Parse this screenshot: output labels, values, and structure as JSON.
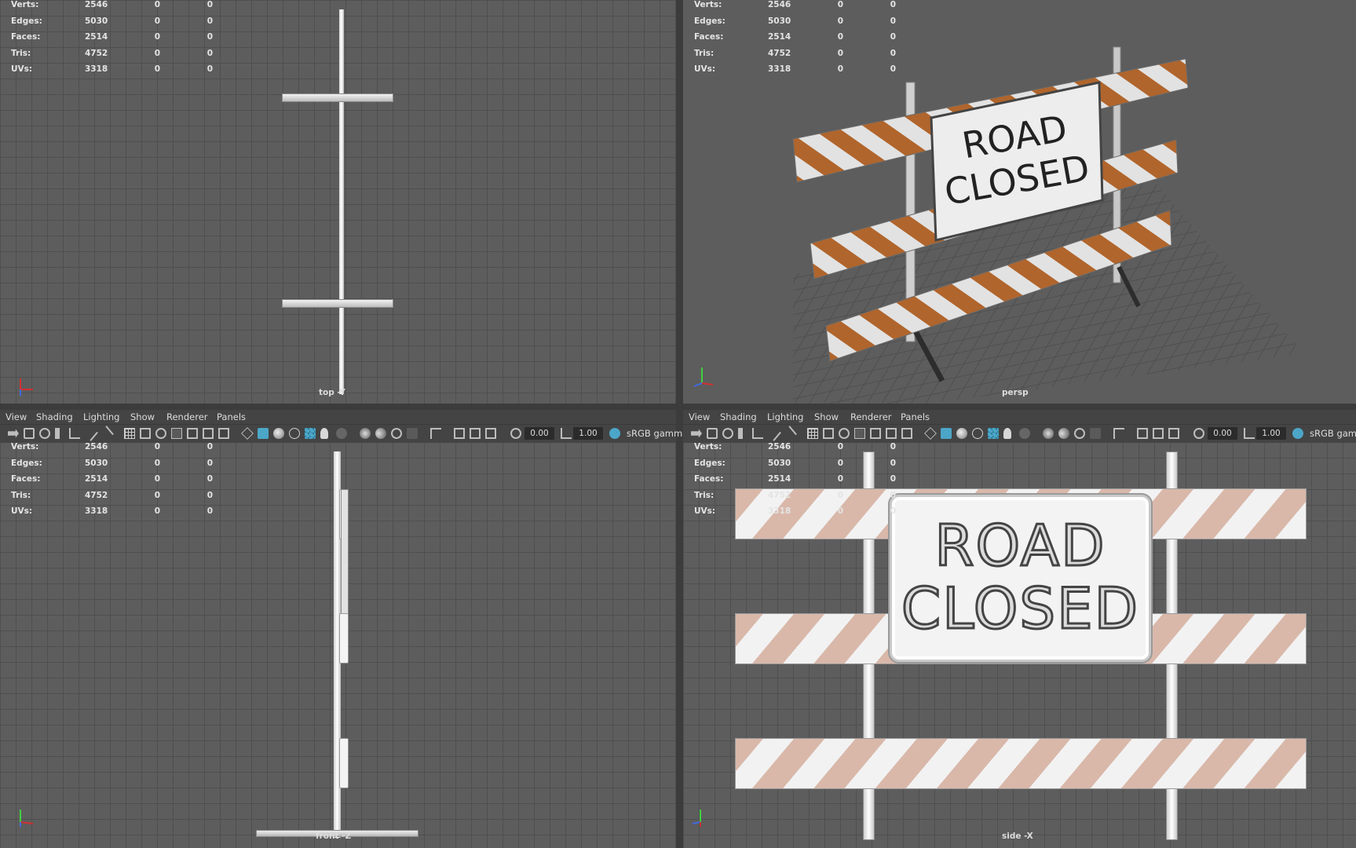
{
  "stats": {
    "rows": [
      {
        "label": "Verts:",
        "v1": "2546",
        "v2": "0",
        "v3": "0"
      },
      {
        "label": "Edges:",
        "v1": "5030",
        "v2": "0",
        "v3": "0"
      },
      {
        "label": "Faces:",
        "v1": "2514",
        "v2": "0",
        "v3": "0"
      },
      {
        "label": "Tris:",
        "v1": "4752",
        "v2": "0",
        "v3": "0"
      },
      {
        "label": "UVs:",
        "v1": "3318",
        "v2": "0",
        "v3": "0"
      }
    ]
  },
  "viewports": {
    "top": {
      "camera": "top -Y"
    },
    "persp": {
      "camera": "persp"
    },
    "front": {
      "camera": "front -Z"
    },
    "side": {
      "camera": "side -X"
    }
  },
  "menu": {
    "view": "View",
    "shading": "Shading",
    "lighting": "Lighting",
    "show": "Show",
    "renderer": "Renderer",
    "panels": "Panels"
  },
  "toolbar": {
    "exposure": "0.00",
    "gamma": "1.00",
    "color_space": "sRGB gamm"
  },
  "sign": {
    "line1": "ROAD",
    "line2": "CLOSED"
  },
  "colors": {
    "grid_bg": "#5d5d5d",
    "stripe_orange": "#b0652c",
    "stripe_pale": "#d9b8aa",
    "axis_x": "#d23030",
    "axis_y": "#3fd13f",
    "axis_z": "#3f6ce0",
    "active_icon": "#4ca6c8"
  }
}
